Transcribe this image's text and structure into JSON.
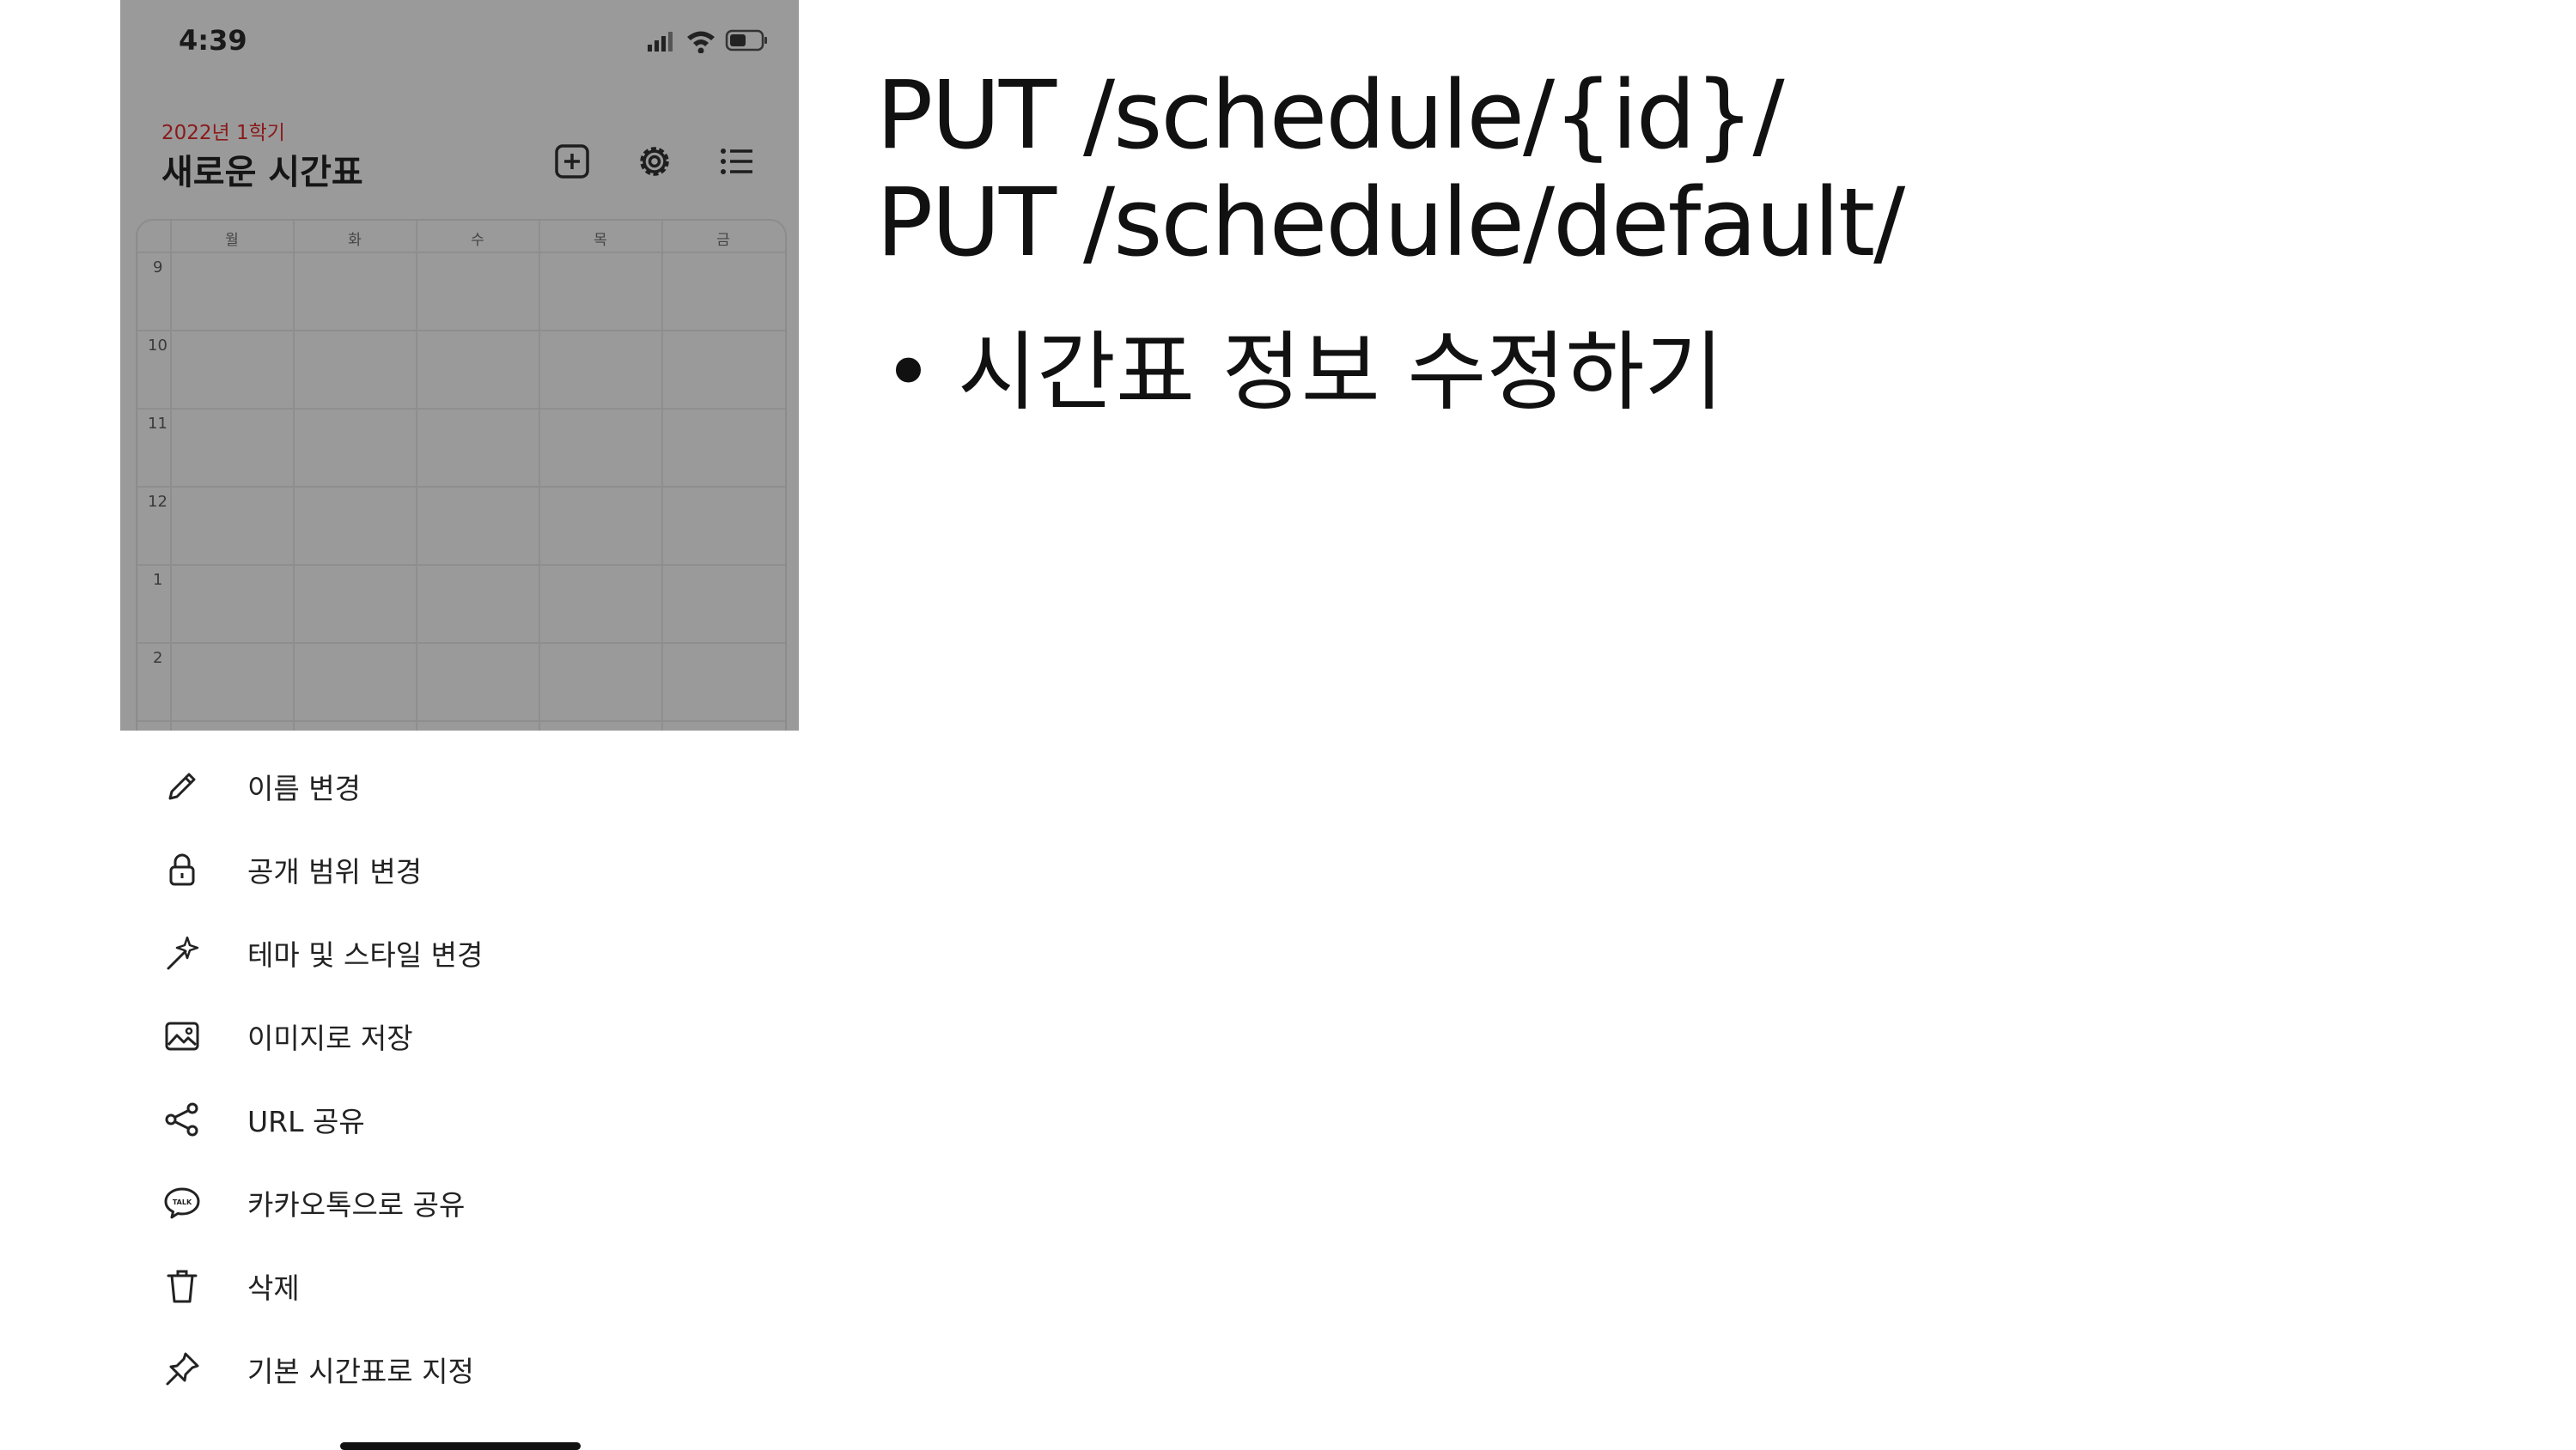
{
  "status_bar": {
    "time": "4:39"
  },
  "timetable": {
    "semester": "2022년 1학기",
    "title": "새로운 시간표",
    "days": [
      "월",
      "화",
      "수",
      "목",
      "금"
    ],
    "hours": [
      "9",
      "10",
      "11",
      "12",
      "1",
      "2"
    ]
  },
  "menu": {
    "items": [
      {
        "label": "이름 변경",
        "icon": "pencil-icon"
      },
      {
        "label": "공개 범위 변경",
        "icon": "lock-icon"
      },
      {
        "label": "테마 및 스타일 변경",
        "icon": "magic-wand-icon"
      },
      {
        "label": "이미지로 저장",
        "icon": "image-icon"
      },
      {
        "label": "URL 공유",
        "icon": "share-icon"
      },
      {
        "label": "카카오톡으로 공유",
        "icon": "talk-bubble-icon"
      },
      {
        "label": "삭제",
        "icon": "trash-icon"
      },
      {
        "label": "기본 시간표로 지정",
        "icon": "pin-icon"
      }
    ]
  },
  "slide": {
    "endpoint_1": "PUT /schedule/{id}/",
    "endpoint_2": "PUT /schedule/default/",
    "bullet": "시간표 정보 수정하기"
  },
  "colors": {
    "dim_overlay": "#9a9a9a",
    "semester_text": "#8a1a1a"
  }
}
